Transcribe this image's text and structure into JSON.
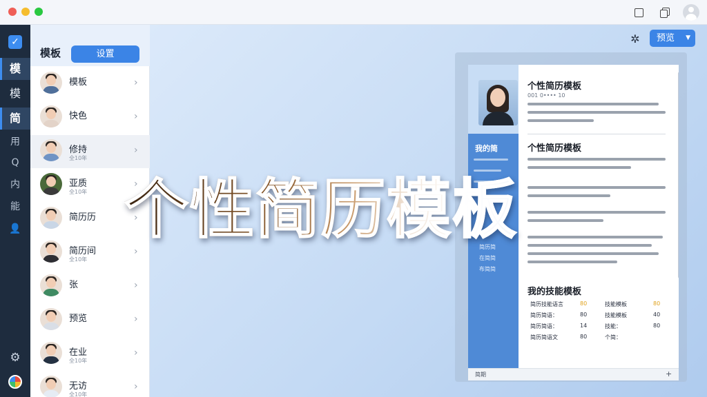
{
  "titlebar": {
    "icons": [
      "window-square-icon",
      "copy-icon",
      "user-avatar-icon"
    ]
  },
  "rail": {
    "logo_icon": "check-square-icon",
    "items": [
      {
        "label": "模",
        "active": true
      },
      {
        "label": "模",
        "active": false
      },
      {
        "label": "简",
        "active": true
      },
      {
        "label": "用",
        "active": false
      },
      {
        "label": "Q",
        "active": false
      },
      {
        "label": "内",
        "active": false
      },
      {
        "label": "能",
        "active": false
      },
      {
        "label": "",
        "icon": "person-icon",
        "active": false
      }
    ],
    "settings_icon": "gear-icon",
    "theme_icon": "color-wheel-icon"
  },
  "panel": {
    "title": "模板",
    "settings_button": "设置",
    "items": [
      {
        "name": "模板",
        "sub": ""
      },
      {
        "name": "快色",
        "sub": ""
      },
      {
        "name": "修持",
        "sub": "全10年"
      },
      {
        "name": "亚质",
        "sub": "全10年"
      },
      {
        "name": "简历历",
        "sub": ""
      },
      {
        "name": "简历间",
        "sub": "全10年"
      },
      {
        "name": "张",
        "sub": ""
      },
      {
        "name": "预览",
        "sub": ""
      },
      {
        "name": "在业",
        "sub": "全10年"
      },
      {
        "name": "无访",
        "sub": "全10年"
      }
    ],
    "selected_index": 2
  },
  "main": {
    "preview_button": "预览",
    "hero_title": "个性简历模板",
    "resume": {
      "title": "个性简历模板",
      "subtitle": "001 0•••• 10",
      "section1": "个性简历模板",
      "side_label": "我的简",
      "side_items": [
        "简历简",
        "在简简",
        "布简简"
      ],
      "section2": "我的技能模板",
      "skills": [
        {
          "left": "简历技能语言",
          "lv1": "80",
          "right": "技能模板",
          "lv2": "80"
        },
        {
          "left": "简历简语：",
          "lv1": "80",
          "right": "技能模板",
          "lv2": "40"
        },
        {
          "left": "简历简语：",
          "lv1": "14",
          "right": "技能：",
          "lv2": "80"
        },
        {
          "left": "简历简语文",
          "lv1": "80",
          "right": "个简：",
          "lv2": ""
        }
      ],
      "footer": "简期"
    }
  }
}
